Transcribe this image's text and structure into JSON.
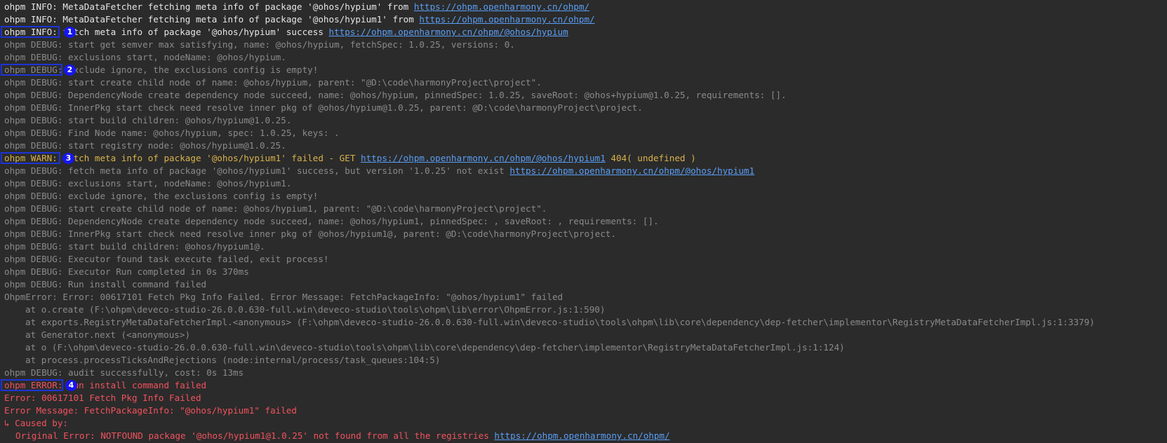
{
  "lines": [
    {
      "level": "info",
      "segments": [
        {
          "text": "ohpm INFO: MetaDataFetcher fetching meta info of package '@ohos/hypium' from "
        },
        {
          "text": "https://ohpm.openharmony.cn/ohpm/",
          "link": true
        }
      ]
    },
    {
      "level": "info",
      "segments": [
        {
          "text": "ohpm INFO: MetaDataFetcher fetching meta info of package '@ohos/hypium1' from "
        },
        {
          "text": "https://ohpm.openharmony.cn/ohpm/",
          "link": true
        }
      ]
    },
    {
      "level": "info",
      "marker": "1",
      "segments": [
        {
          "text": "ohpm INFO: fetch meta info of package '@ohos/hypium' success "
        },
        {
          "text": "https://ohpm.openharmony.cn/ohpm/@ohos/hypium",
          "link": true
        }
      ]
    },
    {
      "level": "debug",
      "segments": [
        {
          "text": "ohpm DEBUG: start get semver max satisfying, name: @ohos/hypium, fetchSpec: 1.0.25, versions: 0."
        }
      ]
    },
    {
      "level": "debug",
      "segments": [
        {
          "text": "ohpm DEBUG: exclusions start, nodeName: @ohos/hypium."
        }
      ]
    },
    {
      "level": "debug",
      "marker": "2",
      "segments": [
        {
          "text": "ohpm DEBUG: exclude ignore, the exclusions config is empty!"
        }
      ]
    },
    {
      "level": "debug",
      "segments": [
        {
          "text": "ohpm DEBUG: start create child node of name: @ohos/hypium, parent: \"@D:\\code\\harmonyProject\\project\"."
        }
      ]
    },
    {
      "level": "debug",
      "segments": [
        {
          "text": "ohpm DEBUG: DependencyNode create dependency node succeed, name: @ohos/hypium, pinnedSpec: 1.0.25, saveRoot: @ohos+hypium@1.0.25, requirements: []."
        }
      ]
    },
    {
      "level": "debug",
      "segments": [
        {
          "text": "ohpm DEBUG: InnerPkg start check need resolve inner pkg of @ohos/hypium@1.0.25, parent: @D:\\code\\harmonyProject\\project."
        }
      ]
    },
    {
      "level": "debug",
      "segments": [
        {
          "text": "ohpm DEBUG: start build children: @ohos/hypium@1.0.25."
        }
      ]
    },
    {
      "level": "debug",
      "segments": [
        {
          "text": "ohpm DEBUG: Find Node name: @ohos/hypium, spec: 1.0.25, keys: ."
        }
      ]
    },
    {
      "level": "debug",
      "segments": [
        {
          "text": "ohpm DEBUG: start registry node: @ohos/hypium@1.0.25."
        }
      ]
    },
    {
      "level": "warn",
      "marker": "3",
      "segments": [
        {
          "text": "ohpm WARN: fetch meta info of package '@ohos/hypium1' failed - GET "
        },
        {
          "text": "https://ohpm.openharmony.cn/ohpm/@ohos/hypium1",
          "link": true
        },
        {
          "text": " 404( undefined )"
        }
      ]
    },
    {
      "level": "debug",
      "segments": [
        {
          "text": "ohpm DEBUG: fetch meta info of package '@ohos/hypium1' success, but version '1.0.25' not exist "
        },
        {
          "text": "https://ohpm.openharmony.cn/ohpm/@ohos/hypium1",
          "link": true
        }
      ]
    },
    {
      "level": "debug",
      "segments": [
        {
          "text": "ohpm DEBUG: exclusions start, nodeName: @ohos/hypium1."
        }
      ]
    },
    {
      "level": "debug",
      "segments": [
        {
          "text": "ohpm DEBUG: exclude ignore, the exclusions config is empty!"
        }
      ]
    },
    {
      "level": "debug",
      "segments": [
        {
          "text": "ohpm DEBUG: start create child node of name: @ohos/hypium1, parent: \"@D:\\code\\harmonyProject\\project\"."
        }
      ]
    },
    {
      "level": "debug",
      "segments": [
        {
          "text": "ohpm DEBUG: DependencyNode create dependency node succeed, name: @ohos/hypium1, pinnedSpec: , saveRoot: , requirements: []."
        }
      ]
    },
    {
      "level": "debug",
      "segments": [
        {
          "text": "ohpm DEBUG: InnerPkg start check need resolve inner pkg of @ohos/hypium1@, parent: @D:\\code\\harmonyProject\\project."
        }
      ]
    },
    {
      "level": "debug",
      "segments": [
        {
          "text": "ohpm DEBUG: start build children: @ohos/hypium1@."
        }
      ]
    },
    {
      "level": "debug",
      "segments": [
        {
          "text": "ohpm DEBUG: Executor found task execute failed, exit process!"
        }
      ]
    },
    {
      "level": "debug",
      "segments": [
        {
          "text": "ohpm DEBUG: Executor Run completed in 0s 370ms"
        }
      ]
    },
    {
      "level": "debug",
      "segments": [
        {
          "text": "ohpm DEBUG: Run install command failed"
        }
      ]
    },
    {
      "level": "debug",
      "segments": [
        {
          "text": "OhpmError: Error: 00617101 Fetch Pkg Info Failed. Error Message: FetchPackageInfo: \"@ohos/hypium1\" failed"
        }
      ]
    },
    {
      "level": "debug",
      "indent": "stack",
      "segments": [
        {
          "text": "at o.create (F:\\ohpm\\deveco-studio-26.0.0.630-full.win\\deveco-studio\\tools\\ohpm\\lib\\error\\OhpmError.js:1:590)"
        }
      ]
    },
    {
      "level": "debug",
      "indent": "stack",
      "segments": [
        {
          "text": "at exports.RegistryMetaDataFetcherImpl.<anonymous> (F:\\ohpm\\deveco-studio-26.0.0.630-full.win\\deveco-studio\\tools\\ohpm\\lib\\core\\dependency\\dep-fetcher\\implementor\\RegistryMetaDataFetcherImpl.js:1:3379)"
        }
      ]
    },
    {
      "level": "debug",
      "indent": "stack",
      "segments": [
        {
          "text": "at Generator.next (<anonymous>)"
        }
      ]
    },
    {
      "level": "debug",
      "indent": "stack",
      "segments": [
        {
          "text": "at o (F:\\ohpm\\deveco-studio-26.0.0.630-full.win\\deveco-studio\\tools\\ohpm\\lib\\core\\dependency\\dep-fetcher\\implementor\\RegistryMetaDataFetcherImpl.js:1:124)"
        }
      ]
    },
    {
      "level": "debug",
      "indent": "stack",
      "segments": [
        {
          "text": "at process.processTicksAndRejections (node:internal/process/task_queues:104:5)"
        }
      ]
    },
    {
      "level": "debug",
      "segments": [
        {
          "text": "ohpm DEBUG: audit successfully, cost: 0s 13ms"
        }
      ]
    },
    {
      "level": "error",
      "marker": "4",
      "segments": [
        {
          "text": "ohpm ERROR: Run install command failed"
        }
      ]
    },
    {
      "level": "error",
      "segments": [
        {
          "text": "Error: 00617101 Fetch Pkg Info Failed"
        }
      ]
    },
    {
      "level": "error",
      "segments": [
        {
          "text": "Error Message: FetchPackageInfo: \"@ohos/hypium1\" failed"
        }
      ]
    },
    {
      "level": "caused",
      "segments": [
        {
          "text": "↳ Caused by:"
        }
      ]
    },
    {
      "level": "error",
      "indent": "small",
      "segments": [
        {
          "text": "Original Error: NOTFOUND package '@ohos/hypium1@1.0.25' not found from all the registries "
        },
        {
          "text": "https://ohpm.openharmony.cn/ohpm/",
          "link": true
        }
      ]
    }
  ],
  "colors": {
    "background": "#2b2b2b",
    "info": "#e6e6e6",
    "debug": "#8a8a8a",
    "warn": "#d8b24a",
    "error": "#f2525d",
    "link": "#5a9ef5",
    "annotation_box": "#1d33d8",
    "annotation_badge": "#1616f0"
  }
}
